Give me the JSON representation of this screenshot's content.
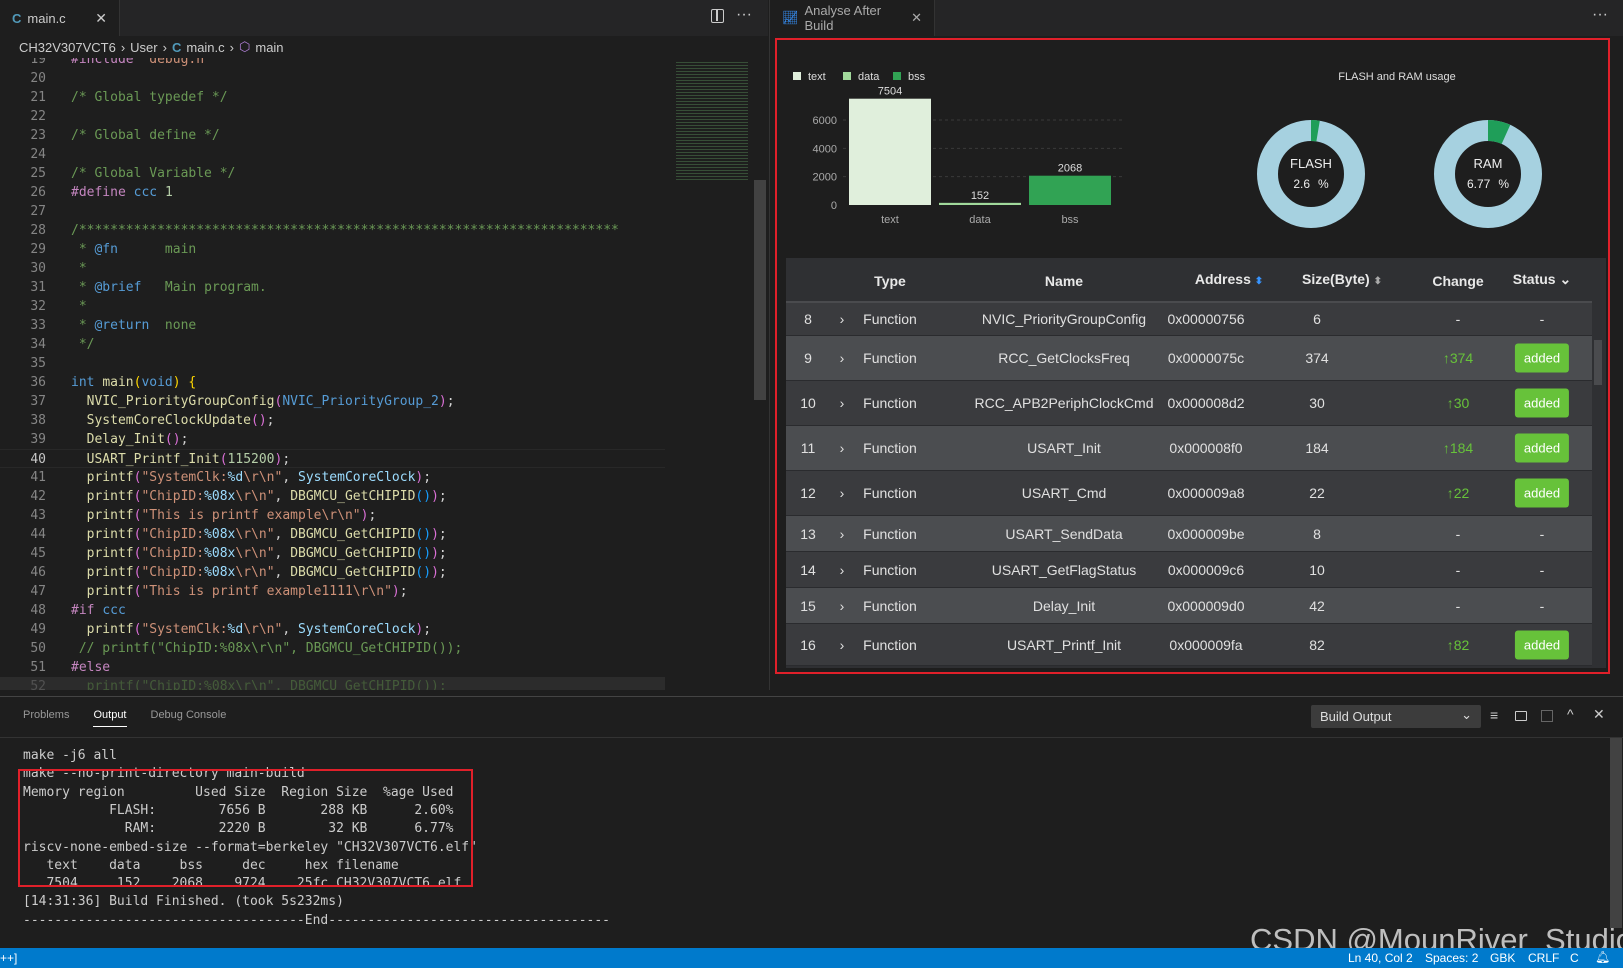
{
  "editor": {
    "tab": {
      "icon": "c-file-icon",
      "label": "main.c"
    },
    "breadcrumb": [
      "CH32V307VCT6",
      "User",
      "main.c",
      "main"
    ],
    "current_line": 40,
    "lines": [
      {
        "n": "19",
        "t": [
          [
            "#include ",
            "pp"
          ],
          [
            "\"debug.h\"",
            "str"
          ]
        ]
      },
      {
        "n": "20",
        "t": []
      },
      {
        "n": "21",
        "t": [
          [
            "/* Global typedef */",
            "cm"
          ]
        ]
      },
      {
        "n": "22",
        "t": []
      },
      {
        "n": "23",
        "t": [
          [
            "/* Global define */",
            "cm"
          ]
        ]
      },
      {
        "n": "24",
        "t": []
      },
      {
        "n": "25",
        "t": [
          [
            "/* Global Variable */",
            "cm"
          ]
        ]
      },
      {
        "n": "26",
        "t": [
          [
            "#define ",
            "pp"
          ],
          [
            "ccc ",
            "kw"
          ],
          [
            "1",
            "num"
          ]
        ]
      },
      {
        "n": "27",
        "t": []
      },
      {
        "n": "28",
        "t": [
          [
            "/*********************************************************************",
            "cm"
          ]
        ]
      },
      {
        "n": "29",
        "t": [
          [
            " * ",
            "cm"
          ],
          [
            "@fn",
            "kw"
          ],
          [
            "      main",
            "cm"
          ]
        ]
      },
      {
        "n": "30",
        "t": [
          [
            " *",
            "cm"
          ]
        ]
      },
      {
        "n": "31",
        "t": [
          [
            " * ",
            "cm"
          ],
          [
            "@brief",
            "kw"
          ],
          [
            "   Main program.",
            "cm"
          ]
        ]
      },
      {
        "n": "32",
        "t": [
          [
            " *",
            "cm"
          ]
        ]
      },
      {
        "n": "33",
        "t": [
          [
            " * ",
            "cm"
          ],
          [
            "@return",
            "kw"
          ],
          [
            "  none",
            "cm"
          ]
        ]
      },
      {
        "n": "34",
        "t": [
          [
            " */",
            "cm"
          ]
        ]
      },
      {
        "n": "35",
        "t": []
      },
      {
        "n": "36",
        "t": [
          [
            "int ",
            "kw"
          ],
          [
            "main",
            "fn"
          ],
          [
            "(",
            "br"
          ],
          [
            "void",
            "kw"
          ],
          [
            ") {",
            "br"
          ]
        ]
      },
      {
        "n": "37",
        "t": [
          [
            "  NVIC_PriorityGroupConfig",
            "fn"
          ],
          [
            "(",
            "br2"
          ],
          [
            "NVIC_PriorityGroup_2",
            "kw"
          ],
          [
            ")",
            "br2"
          ],
          [
            ";",
            "pl"
          ]
        ]
      },
      {
        "n": "38",
        "t": [
          [
            "  SystemCoreClockUpdate",
            "fn"
          ],
          [
            "()",
            "br2"
          ],
          [
            ";",
            "pl"
          ]
        ]
      },
      {
        "n": "39",
        "t": [
          [
            "  Delay_Init",
            "fn"
          ],
          [
            "()",
            "br2"
          ],
          [
            ";",
            "pl"
          ]
        ]
      },
      {
        "n": "40",
        "t": [
          [
            "  USART_Printf_Init",
            "fn"
          ],
          [
            "(",
            "br2"
          ],
          [
            "115200",
            "num"
          ],
          [
            ")",
            "br2"
          ],
          [
            ";",
            "pl"
          ]
        ]
      },
      {
        "n": "41",
        "t": [
          [
            "  printf",
            "fn"
          ],
          [
            "(",
            "br2"
          ],
          [
            "\"SystemClk:",
            "str"
          ],
          [
            "%d",
            "fmt"
          ],
          [
            "\\r\\n\"",
            "str"
          ],
          [
            ", ",
            "pl"
          ],
          [
            "SystemCoreClock",
            "var"
          ],
          [
            ")",
            "br2"
          ],
          [
            ";",
            "pl"
          ]
        ]
      },
      {
        "n": "42",
        "t": [
          [
            "  printf",
            "fn"
          ],
          [
            "(",
            "br2"
          ],
          [
            "\"ChipID:",
            "str"
          ],
          [
            "%08x",
            "fmt"
          ],
          [
            "\\r\\n\"",
            "str"
          ],
          [
            ", ",
            "pl"
          ],
          [
            "DBGMCU_GetCHIPID",
            "fn"
          ],
          [
            "()",
            "br3"
          ],
          [
            ")",
            "br2"
          ],
          [
            ";",
            "pl"
          ]
        ]
      },
      {
        "n": "43",
        "t": [
          [
            "  printf",
            "fn"
          ],
          [
            "(",
            "br2"
          ],
          [
            "\"This is printf example\\r\\n\"",
            "str"
          ],
          [
            ")",
            "br2"
          ],
          [
            ";",
            "pl"
          ]
        ]
      },
      {
        "n": "44",
        "t": [
          [
            "  printf",
            "fn"
          ],
          [
            "(",
            "br2"
          ],
          [
            "\"ChipID:",
            "str"
          ],
          [
            "%08x",
            "fmt"
          ],
          [
            "\\r\\n\"",
            "str"
          ],
          [
            ", ",
            "pl"
          ],
          [
            "DBGMCU_GetCHIPID",
            "fn"
          ],
          [
            "()",
            "br3"
          ],
          [
            ")",
            "br2"
          ],
          [
            ";",
            "pl"
          ]
        ]
      },
      {
        "n": "45",
        "t": [
          [
            "  printf",
            "fn"
          ],
          [
            "(",
            "br2"
          ],
          [
            "\"ChipID:",
            "str"
          ],
          [
            "%08x",
            "fmt"
          ],
          [
            "\\r\\n\"",
            "str"
          ],
          [
            ", ",
            "pl"
          ],
          [
            "DBGMCU_GetCHIPID",
            "fn"
          ],
          [
            "()",
            "br3"
          ],
          [
            ")",
            "br2"
          ],
          [
            ";",
            "pl"
          ]
        ]
      },
      {
        "n": "46",
        "t": [
          [
            "  printf",
            "fn"
          ],
          [
            "(",
            "br2"
          ],
          [
            "\"ChipID:",
            "str"
          ],
          [
            "%08x",
            "fmt"
          ],
          [
            "\\r\\n\"",
            "str"
          ],
          [
            ", ",
            "pl"
          ],
          [
            "DBGMCU_GetCHIPID",
            "fn"
          ],
          [
            "()",
            "br3"
          ],
          [
            ")",
            "br2"
          ],
          [
            ";",
            "pl"
          ]
        ]
      },
      {
        "n": "47",
        "t": [
          [
            "  printf",
            "fn"
          ],
          [
            "(",
            "br2"
          ],
          [
            "\"This is printf example1111\\r\\n\"",
            "str"
          ],
          [
            ")",
            "br2"
          ],
          [
            ";",
            "pl"
          ]
        ]
      },
      {
        "n": "48",
        "t": [
          [
            "#if ",
            "pp"
          ],
          [
            "ccc",
            "kw"
          ]
        ]
      },
      {
        "n": "49",
        "t": [
          [
            "  printf",
            "fn"
          ],
          [
            "(",
            "br2"
          ],
          [
            "\"SystemClk:",
            "str"
          ],
          [
            "%d",
            "fmt"
          ],
          [
            "\\r\\n\"",
            "str"
          ],
          [
            ", ",
            "pl"
          ],
          [
            "SystemCoreClock",
            "var"
          ],
          [
            ")",
            "br2"
          ],
          [
            ";",
            "pl"
          ]
        ]
      },
      {
        "n": "50",
        "t": [
          [
            " // printf(\"ChipID:%08x\\r\\n\", DBGMCU_GetCHIPID());",
            "cm"
          ]
        ]
      },
      {
        "n": "51",
        "t": [
          [
            "#else",
            "pp"
          ]
        ]
      },
      {
        "n": "52",
        "t": [
          [
            "  printf(\"ChipID:%08x\\r\\n\", DBGMCU_GetCHIPID());",
            "cm"
          ]
        ]
      }
    ]
  },
  "analysis": {
    "tab": {
      "icon": "chart-icon",
      "label": "Analyse After Build"
    },
    "chart_data": [
      {
        "type": "bar",
        "categories": [
          "text",
          "data",
          "bss"
        ],
        "values": [
          7504,
          152,
          2068
        ],
        "series": [
          {
            "name": "text",
            "color": "#e0efdc"
          },
          {
            "name": "data",
            "color": "#a1d99b"
          },
          {
            "name": "bss",
            "color": "#31a354"
          }
        ],
        "yticks": [
          0,
          2000,
          4000,
          6000
        ],
        "ylim": [
          0,
          7504
        ],
        "legend": "top-left",
        "grid": true
      },
      {
        "type": "pie",
        "title": "FLASH and RAM usage",
        "donuts": [
          {
            "label": "FLASH",
            "value_text": "2.6",
            "unit": "%",
            "percent": 2.6
          },
          {
            "label": "RAM",
            "value_text": "6.77",
            "unit": "%",
            "percent": 6.77
          }
        ],
        "used_color": "#1f9e59",
        "free_color": "#a6d1e0"
      }
    ],
    "table": {
      "headers": {
        "type": "Type",
        "name": "Name",
        "address": "Address",
        "size": "Size(Byte)",
        "change": "Change",
        "status": "Status"
      },
      "rows": [
        {
          "idx": "8",
          "type": "Function",
          "name": "NVIC_PriorityGroupConfig",
          "address": "0x00000756",
          "size": "6",
          "change": "-",
          "status": "-"
        },
        {
          "idx": "9",
          "type": "Function",
          "name": "RCC_GetClocksFreq",
          "address": "0x0000075c",
          "size": "374",
          "change": "↑374",
          "status": "added"
        },
        {
          "idx": "10",
          "type": "Function",
          "name": "RCC_APB2PeriphClockCmd",
          "address": "0x000008d2",
          "size": "30",
          "change": "↑30",
          "status": "added"
        },
        {
          "idx": "11",
          "type": "Function",
          "name": "USART_Init",
          "address": "0x000008f0",
          "size": "184",
          "change": "↑184",
          "status": "added"
        },
        {
          "idx": "12",
          "type": "Function",
          "name": "USART_Cmd",
          "address": "0x000009a8",
          "size": "22",
          "change": "↑22",
          "status": "added"
        },
        {
          "idx": "13",
          "type": "Function",
          "name": "USART_SendData",
          "address": "0x000009be",
          "size": "8",
          "change": "-",
          "status": "-"
        },
        {
          "idx": "14",
          "type": "Function",
          "name": "USART_GetFlagStatus",
          "address": "0x000009c6",
          "size": "10",
          "change": "-",
          "status": "-"
        },
        {
          "idx": "15",
          "type": "Function",
          "name": "Delay_Init",
          "address": "0x000009d0",
          "size": "42",
          "change": "-",
          "status": "-"
        },
        {
          "idx": "16",
          "type": "Function",
          "name": "USART_Printf_Init",
          "address": "0x000009fa",
          "size": "82",
          "change": "↑82",
          "status": "added"
        }
      ]
    }
  },
  "panel": {
    "tabs": [
      "Problems",
      "Output",
      "Debug Console"
    ],
    "active_tab": "Output",
    "channel": "Build Output",
    "lines": [
      "make -j6 all",
      "make --no-print-directory main-build",
      "Memory region         Used Size  Region Size  %age Used",
      "           FLASH:        7656 B       288 KB      2.60%",
      "             RAM:        2220 B        32 KB      6.77%",
      "riscv-none-embed-size --format=berkeley \"CH32V307VCT6.elf\"",
      "   text    data     bss     dec     hex filename",
      "   7504     152    2068    9724    25fc CH32V307VCT6.elf",
      "[14:31:36] Build Finished. (took 5s232ms)",
      "------------------------------------End------------------------------------"
    ]
  },
  "status": {
    "left": "++]",
    "ln_col": "Ln 40, Col 2",
    "spaces": "Spaces: 2",
    "encoding": "GBK",
    "eol": "CRLF",
    "lang": "C"
  },
  "watermark": "CSDN @MounRiver_Studio"
}
